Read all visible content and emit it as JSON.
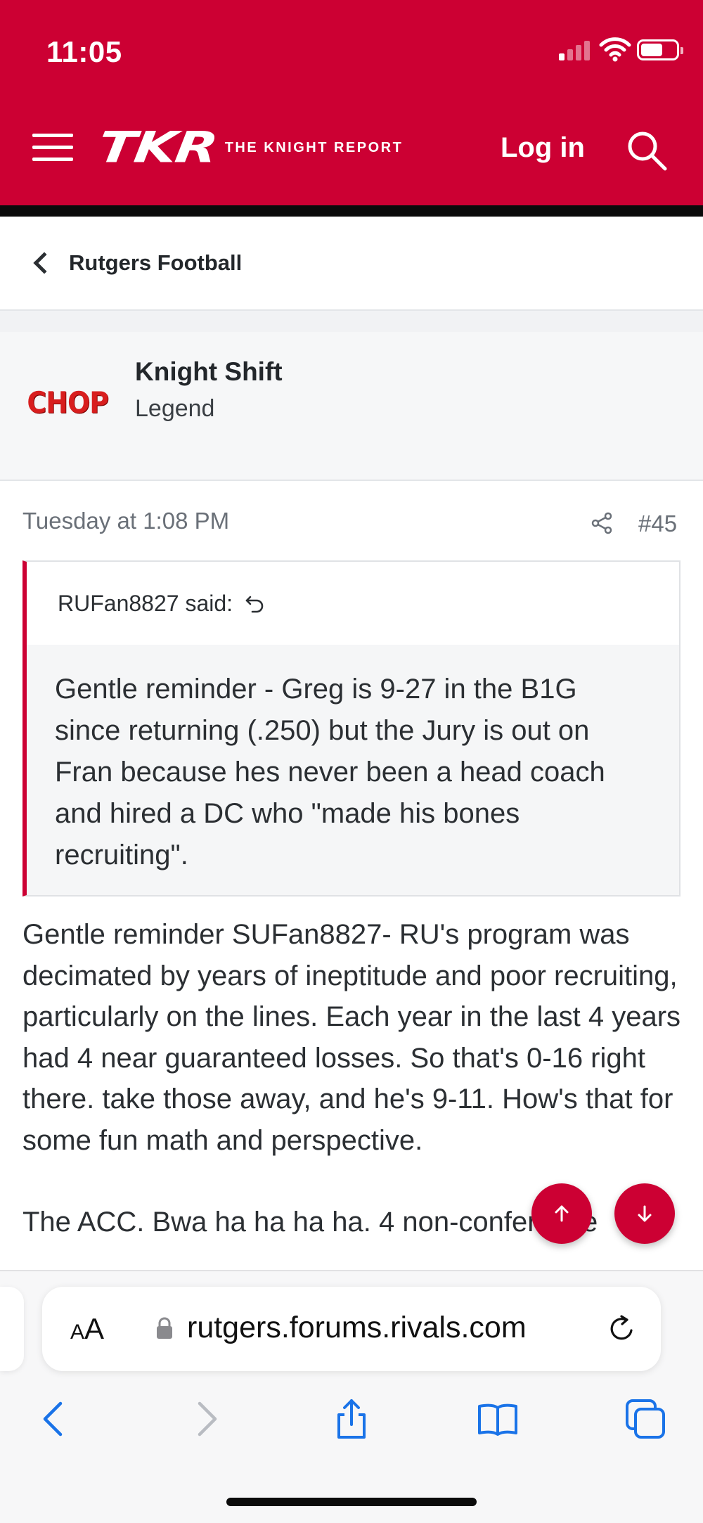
{
  "status_bar": {
    "time": "11:05"
  },
  "header": {
    "logo": "TKR",
    "logo_sub": "THE KNIGHT REPORT",
    "login": "Log in",
    "colors": {
      "brand": "#cc0033",
      "bar": "#0b0b0b"
    }
  },
  "breadcrumb": {
    "label": "Rutgers Football"
  },
  "user": {
    "avatar_text": "CHOP",
    "name": "Knight Shift",
    "title": "Legend"
  },
  "post": {
    "date": "Tuesday at 1:08 PM",
    "number": "#45",
    "quote": {
      "author": "RUFan8827 said:",
      "text": "Gentle reminder - Greg is 9-27 in the B1G since returning (.250) but the Jury is out on Fran because hes never been a head coach and hired a DC who \"made his bones recruiting\"."
    },
    "body": "Gentle reminder SUFan8827- RU's program was decimated by years of ineptitude and poor recruiting, particularly on the lines. Each year in the last 4 years had 4 near guaranteed losses. So that's 0-16 right there. take those away, and he's 9-11. How's that for some fun math and perspective.",
    "body_cut": "The ACC. Bwa ha ha ha ha. 4 non-conference"
  },
  "browser": {
    "aa_label_big": "A",
    "aa_label_small": "A",
    "url": "rutgers.forums.rivals.com"
  },
  "icons": {
    "menu": "hamburger-icon",
    "search": "search-icon",
    "share": "share-icon",
    "reply": "reply-arrow-icon",
    "up": "arrow-up-icon",
    "down": "arrow-down-icon",
    "lock": "lock-icon",
    "reload": "reload-icon",
    "back": "back-icon",
    "forward": "forward-icon",
    "share_sheet": "share-sheet-icon",
    "bookmarks": "bookmarks-icon",
    "tabs": "tabs-icon"
  }
}
